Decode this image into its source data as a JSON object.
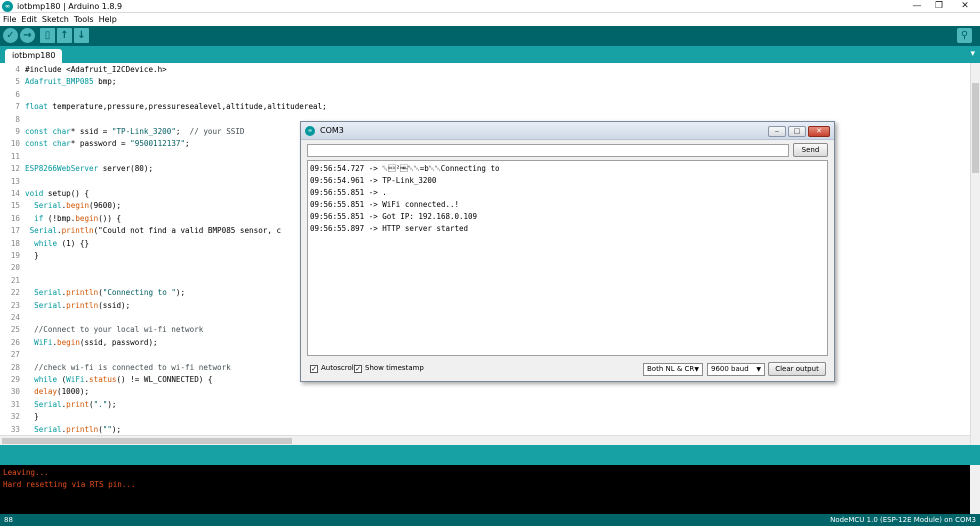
{
  "window": {
    "title": "iotbmp180 | Arduino 1.8.9",
    "icon": "arduino-logo-icon"
  },
  "menu": [
    "File",
    "Edit",
    "Sketch",
    "Tools",
    "Help"
  ],
  "toolbar": {
    "buttons": [
      "verify-icon",
      "upload-icon",
      "new-icon",
      "open-icon",
      "save-icon"
    ],
    "serial_monitor_icon": "magnifier-icon"
  },
  "tab": {
    "label": "iotbmp180",
    "menu_icon": "chevron-down-icon"
  },
  "editor": {
    "lines": [
      {
        "n": "4",
        "t": "#include <Adafruit_I2CDevice.h>"
      },
      {
        "n": "5",
        "t": "Adafruit_BMP085 bmp;"
      },
      {
        "n": "6",
        "t": ""
      },
      {
        "n": "7",
        "t": "float temperature,pressure,pressuresealevel,altitude,altitudereal;"
      },
      {
        "n": "8",
        "t": ""
      },
      {
        "n": "9",
        "t": "const char* ssid = \"TP-Link_3200\";  // your SSID"
      },
      {
        "n": "10",
        "t": "const char* password = \"9500112137\";"
      },
      {
        "n": "11",
        "t": ""
      },
      {
        "n": "12",
        "t": "ESP8266WebServer server(80);"
      },
      {
        "n": "13",
        "t": ""
      },
      {
        "n": "14",
        "t": "void setup() {"
      },
      {
        "n": "15",
        "t": "  Serial.begin(9600);"
      },
      {
        "n": "16",
        "t": "  if (!bmp.begin()) {"
      },
      {
        "n": "17",
        "t": " Serial.println(\"Could not find a valid BMP085 sensor, c"
      },
      {
        "n": "18",
        "t": "  while (1) {}"
      },
      {
        "n": "19",
        "t": "  }"
      },
      {
        "n": "20",
        "t": ""
      },
      {
        "n": "21",
        "t": ""
      },
      {
        "n": "22",
        "t": "  Serial.println(\"Connecting to \");"
      },
      {
        "n": "23",
        "t": "  Serial.println(ssid);"
      },
      {
        "n": "24",
        "t": ""
      },
      {
        "n": "25",
        "t": "  //Connect to your local wi-fi network"
      },
      {
        "n": "26",
        "t": "  WiFi.begin(ssid, password);"
      },
      {
        "n": "27",
        "t": ""
      },
      {
        "n": "28",
        "t": "  //check wi-fi is connected to wi-fi network"
      },
      {
        "n": "29",
        "t": "  while (WiFi.status() != WL_CONNECTED) {"
      },
      {
        "n": "30",
        "t": "  delay(1000);"
      },
      {
        "n": "31",
        "t": "  Serial.print(\".\");"
      },
      {
        "n": "32",
        "t": "  }"
      },
      {
        "n": "33",
        "t": "  Serial.println(\"\");"
      }
    ]
  },
  "console": {
    "lines": [
      "Leaving...",
      "Hard resetting via RTS pin..."
    ]
  },
  "statusbar": {
    "line_number": "88",
    "board": "NodeMCU 1.0 (ESP-12E Module) on COM3"
  },
  "serial_monitor": {
    "title": "COM3",
    "send_label": "Send",
    "input_value": "",
    "output": [
      "09:56:54.727 -> ␀\u0013²␀␀=b␀␀Connecting to",
      "09:56:54.961 -> TP-Link_3200",
      "09:56:55.851 -> .",
      "09:56:55.851 -> WiFi connected..!",
      "09:56:55.851 -> Got IP: 192.168.0.109",
      "09:56:55.897 -> HTTP server started"
    ],
    "autoscroll_label": "Autoscroll",
    "autoscroll_checked": true,
    "timestamp_label": "Show timestamp",
    "timestamp_checked": true,
    "line_ending": "Both NL & CR",
    "baud": "9600 baud",
    "clear_label": "Clear output"
  }
}
